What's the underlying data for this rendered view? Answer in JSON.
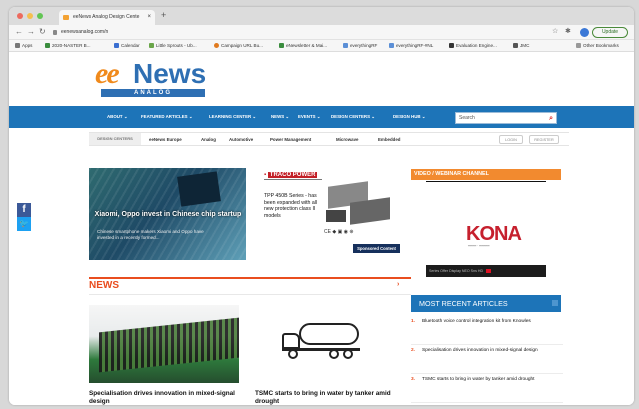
{
  "browser": {
    "tab_title": "eeNews Analog Design Cente",
    "tab_close": "×",
    "new_tab": "+",
    "url": "eenewsanalog.com/n",
    "update_label": "Update",
    "bookmarks": [
      "Apps",
      "2020-NASTER B...",
      "Calendar",
      "Little Sprouts - Ub...",
      "Campaign URL Bu...",
      "eNewsletter & Mai...",
      "everythingRF",
      "everythingRF-#NL",
      "Evaluation Engine...",
      "JMC",
      "Other Bookmarks"
    ],
    "colors": {
      "close": "#ed6a5e",
      "minimize": "#f5bf4f",
      "maximize": "#62c554"
    }
  },
  "site": {
    "logo_ee": "ee",
    "logo_news": "News",
    "logo_sub": "ANALOG",
    "nav": [
      "ABOUT",
      "FEATURED ARTICLES",
      "LEARNING CENTER",
      "NEWS",
      "EVENTS",
      "DESIGN CENTERS",
      "DESIGN HUB"
    ],
    "search_placeholder": "Search",
    "subnav_label": "DESIGN CENTERS",
    "subnav": [
      "eeNews Europe",
      "Analog",
      "Automotive",
      "Power Management",
      "Microwave",
      "Embedded"
    ],
    "login": "LOGIN",
    "register": "REGISTER",
    "accent": "#1d74b8",
    "orange": "#e94d1f"
  },
  "social": {
    "facebook": "f",
    "twitter": "t"
  },
  "hero": {
    "title": "Xiaomi, Oppo invest in Chinese chip startup",
    "summary": "Chinese smartphone makers Xiaomi and Oppo have invested in a recently formed..."
  },
  "ad": {
    "brand": "TRACO POWER",
    "body": "TPP 450B Series - has been expanded with all new protection class II models",
    "sponsored": "Sponsored Content"
  },
  "video": {
    "heading": "VIDEO / WEBINAR CHANNEL",
    "logo": "KONA",
    "caption": "Series Offer Display NEO Sns HD"
  },
  "news": {
    "heading": "NEWS",
    "arrow": "›",
    "items": [
      {
        "title": "Specialisation drives innovation in mixed-signal design"
      },
      {
        "title": "TSMC starts to bring in water by tanker amid drought"
      }
    ]
  },
  "recent": {
    "heading": "MOST RECENT ARTICLES",
    "items": [
      {
        "num": "1.",
        "title": "Bluetooth voice control integration kit from Knowles"
      },
      {
        "num": "2.",
        "title": "Specialisation drives innovation in mixed-signal design"
      },
      {
        "num": "3.",
        "title": "TSMC starts to bring in water by tanker amid drought"
      }
    ]
  }
}
